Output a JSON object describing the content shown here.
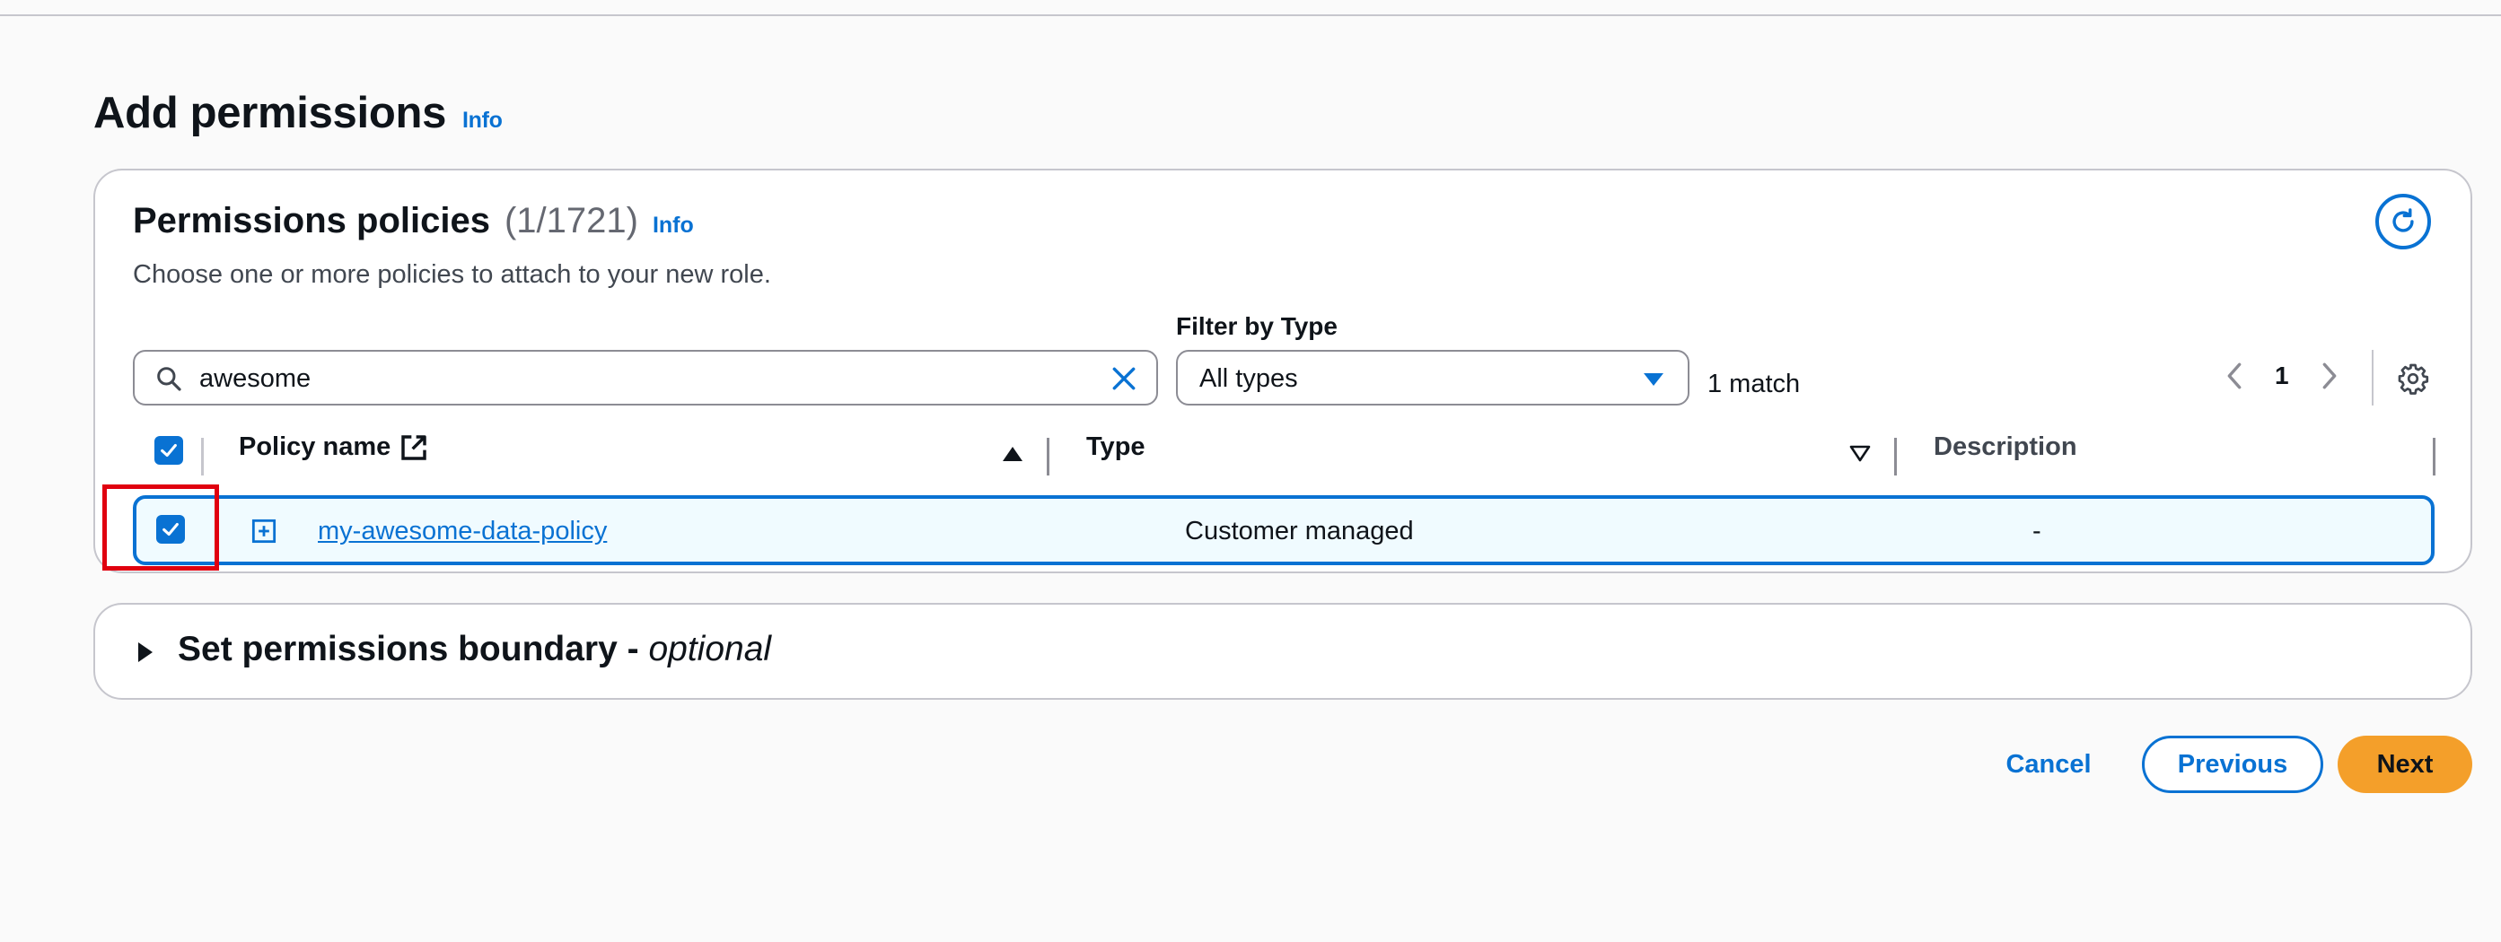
{
  "page": {
    "title": "Add permissions",
    "info_label": "Info"
  },
  "permissions": {
    "title": "Permissions policies",
    "count": "(1/1721)",
    "info_label": "Info",
    "description": "Choose one or more policies to attach to your new role.",
    "search": {
      "value": "awesome",
      "placeholder": ""
    },
    "filter_label": "Filter by Type",
    "filter_value": "All types",
    "match_text": "1 match",
    "page_number": "1",
    "columns": {
      "name": "Policy name",
      "type": "Type",
      "description": "Description"
    },
    "rows": [
      {
        "name": "my-awesome-data-policy",
        "type": "Customer managed",
        "description": "-",
        "selected": true
      }
    ]
  },
  "boundary": {
    "title": "Set permissions boundary - ",
    "optional": "optional"
  },
  "footer": {
    "cancel": "Cancel",
    "previous": "Previous",
    "next": "Next"
  },
  "colors": {
    "accent": "#0972d3",
    "primary_button": "#f49f2a",
    "highlight": "#e0000f"
  }
}
